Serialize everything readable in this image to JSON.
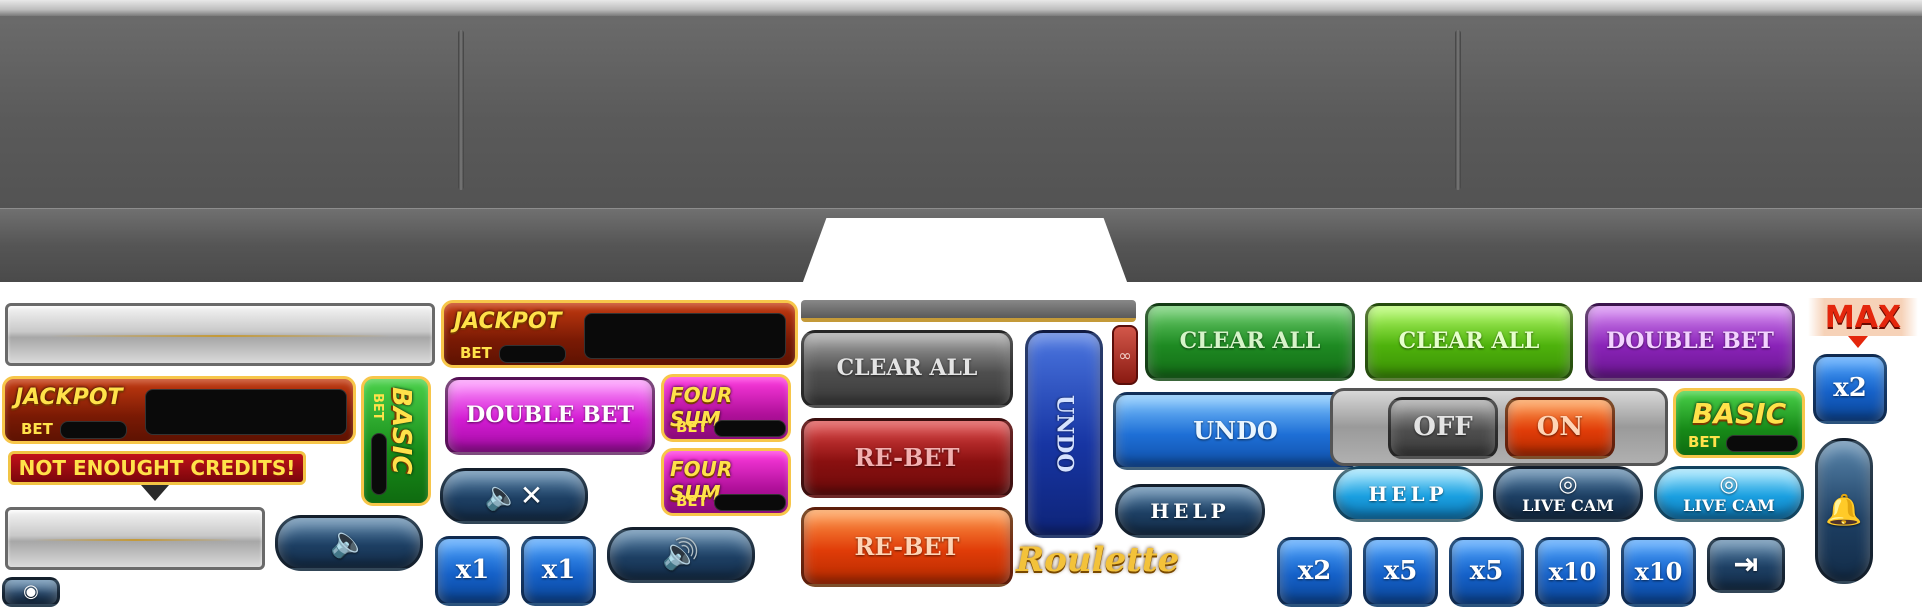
{
  "buttons": {
    "clear_all": "CLEAR ALL",
    "rebet": "RE-BET",
    "undo": "UNDO",
    "help": "HELP",
    "double_bet": "DOUBLE BET",
    "off": "OFF",
    "on": "ON",
    "live_cam": "LIVE CAM",
    "max": "MAX"
  },
  "badges": {
    "jackpot": "JACKPOT",
    "bet": "BET",
    "four_sum": "FOUR SUM",
    "basic": "BASIC"
  },
  "warning": "NOT ENOUGHT CREDITS!",
  "multipliers": {
    "x1": "x1",
    "x2": "x2",
    "x5": "x5",
    "x10": "x10"
  },
  "logo_text": "Roulette",
  "icons": [
    "eye-icon",
    "speaker-icon",
    "speaker-mute-icon",
    "speaker-sound-icon",
    "exit-icon",
    "link-icon",
    "bell-icon",
    "camera-icon"
  ],
  "colors": {
    "gold": "#ffe24a",
    "panel": "#555555",
    "jackpot": "#7a1a04",
    "four_sum": "#b0109a",
    "basic": "#178a18"
  }
}
